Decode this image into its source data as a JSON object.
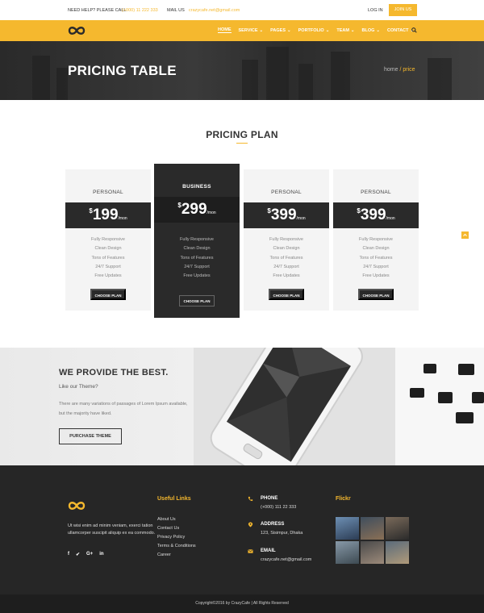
{
  "topbar": {
    "help_label": "NEED HELP? PLEASE CALL",
    "phone": "(+000) 11 222 333",
    "mail_label": "MAIL US",
    "email": "crazycafe.net@gmail.com",
    "login": "LOG IN",
    "join": "JOIN US"
  },
  "nav": {
    "items": [
      {
        "label": "HOME"
      },
      {
        "label": "SERVICE"
      },
      {
        "label": "PAGES"
      },
      {
        "label": "PORTFOLIO"
      },
      {
        "label": "TEAM"
      },
      {
        "label": "BLOG"
      },
      {
        "label": "CONTACT"
      }
    ]
  },
  "banner": {
    "title": "PRICING TABLE",
    "crumb_home": "home",
    "crumb_current": "/ price"
  },
  "pricing": {
    "title": "PRICING PLAN",
    "currency": "$",
    "per": "/mon",
    "plans": [
      {
        "name": "PERSONAL",
        "price": "199",
        "features": [
          "Fully Responsive",
          "Clean Design",
          "Tons of Features",
          "24/7 Support",
          "Free Updates"
        ],
        "button": "CHOOSE PLAN"
      },
      {
        "name": "BUSINESS",
        "price": "299",
        "features": [
          "Fully Responsive",
          "Clean Design",
          "Tons of Features",
          "24/7 Support",
          "Free Updates"
        ],
        "button": "CHOOSE PLAN"
      },
      {
        "name": "PERSONAL",
        "price": "399",
        "features": [
          "Fully Responsive",
          "Clean Design",
          "Tons of Features",
          "24/7 Support",
          "Free Updates"
        ],
        "button": "CHOOSE PLAN"
      },
      {
        "name": "PERSONAL",
        "price": "399",
        "features": [
          "Fully Responsive",
          "Clean Design",
          "Tons of Features",
          "24/7 Support",
          "Free Updates"
        ],
        "button": "CHOOSE PLAN"
      }
    ]
  },
  "promo": {
    "title": "WE PROVIDE THE BEST.",
    "subtitle": "Like our Theme?",
    "body": "There are many variations of passages of Lorem Ipsum available, but the majority have liked.",
    "button": "PURCHASE THEME"
  },
  "footer": {
    "description": "Ut wisi enim ad minim veniam, exerci tation ullamcorper suscipit aliquip ex ea commodo.",
    "social": [
      "f",
      "✔",
      "G+",
      "in"
    ],
    "links_title": "Useful Links",
    "links": [
      "About Us",
      "Contact Us",
      "Privacy Policy",
      "Terms & Conditions",
      "Career"
    ],
    "phone_label": "PHONE",
    "phone": "(+000) 111 22 333",
    "address_label": "ADDRESS",
    "address": "123, Sisimpur, Dhaka",
    "email_label": "EMAIL",
    "email": "crazycafe.net@gmail.com",
    "flickr_title": "Flickr",
    "copyright": "Copyright©2016 by CrazyCafe  |  All Rights Reserved"
  },
  "colors": {
    "accent": "#f5b82e",
    "dark": "#2a2a2a",
    "footer": "#262626"
  }
}
